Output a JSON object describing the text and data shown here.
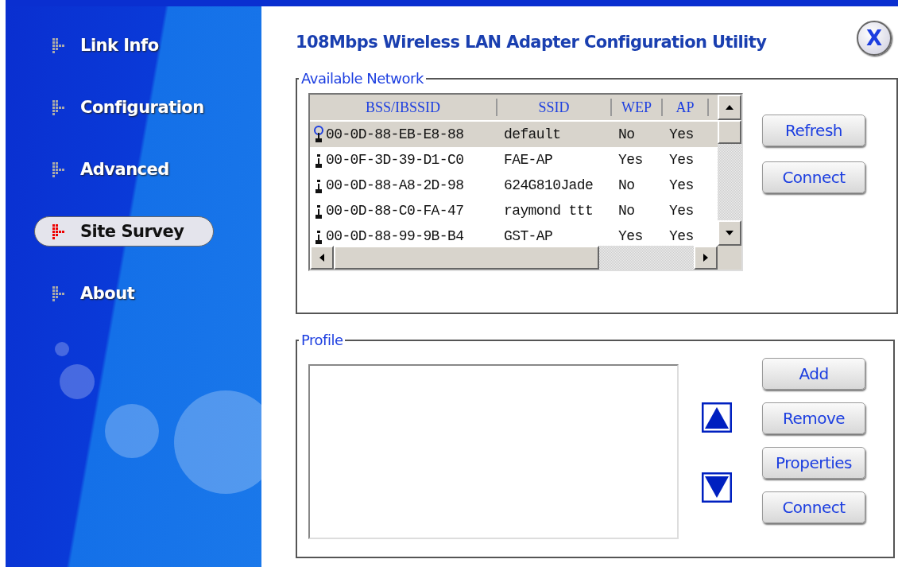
{
  "sidebar": {
    "items": [
      {
        "label": "Link Info",
        "selected": false
      },
      {
        "label": "Configuration",
        "selected": false
      },
      {
        "label": "Advanced",
        "selected": false
      },
      {
        "label": "Site Survey",
        "selected": true
      },
      {
        "label": "About",
        "selected": false
      }
    ]
  },
  "title": "108Mbps Wireless LAN Adapter Configuration Utility",
  "close_button": "X",
  "available_network": {
    "legend": "Available Network",
    "columns": [
      "BSS/IBSSID",
      "SSID",
      "WEP",
      "AP"
    ],
    "rows": [
      {
        "bssid": "00-0D-88-EB-E8-88",
        "ssid": "default",
        "wep": "No",
        "ap": "Yes",
        "selected": true,
        "connected": true
      },
      {
        "bssid": "00-0F-3D-39-D1-C0",
        "ssid": "FAE-AP",
        "wep": "Yes",
        "ap": "Yes",
        "selected": false,
        "connected": false
      },
      {
        "bssid": "00-0D-88-A8-2D-98",
        "ssid": "624G810Jade",
        "wep": "No",
        "ap": "Yes",
        "selected": false,
        "connected": false
      },
      {
        "bssid": "00-0D-88-C0-FA-47",
        "ssid": "raymond ttt",
        "wep": "No",
        "ap": "Yes",
        "selected": false,
        "connected": false
      },
      {
        "bssid": "00-0D-88-99-9B-B4",
        "ssid": "GST-AP",
        "wep": "Yes",
        "ap": "Yes",
        "selected": false,
        "connected": false
      }
    ],
    "buttons": [
      "Refresh",
      "Connect"
    ]
  },
  "profile": {
    "legend": "Profile",
    "buttons": [
      "Add",
      "Remove",
      "Properties",
      "Connect"
    ]
  }
}
